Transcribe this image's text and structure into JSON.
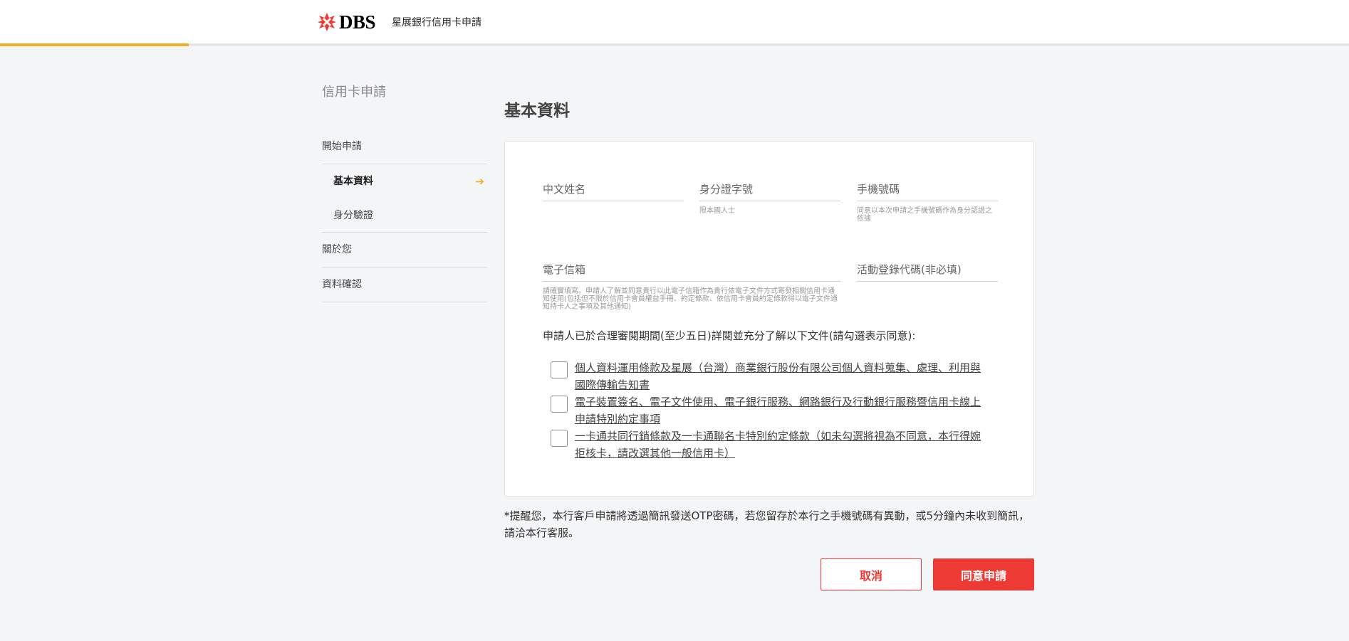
{
  "header": {
    "logo_text": "DBS",
    "title": "星展銀行信用卡申請",
    "progress": 0.14,
    "accent_color": "#f6ad23",
    "brand_color": "#ee3a34"
  },
  "sidebar": {
    "heading": "信用卡申請",
    "items": [
      {
        "label": "開始申請"
      },
      {
        "label": "基本資料",
        "active": true
      },
      {
        "label": "身分驗證"
      },
      {
        "label": "關於您"
      },
      {
        "label": "資料確認"
      }
    ],
    "active_icon": "arrow-right-icon"
  },
  "main": {
    "title": "基本資料",
    "fields": {
      "chinese_name": {
        "label": "中文姓名"
      },
      "id_number": {
        "label": "身分證字號",
        "hint": "限本國人士"
      },
      "mobile": {
        "label": "手機號碼",
        "hint": "同意以本次申請之手機號碼作為身分認證之依據"
      },
      "email": {
        "label": "電子信箱",
        "hint": "請確實填寫。申請人了解並同意貴行以此電子信箱作為貴行依電子文件方式寄發相關信用卡通知使用(包括但不限於信用卡會員權益手冊、約定條款、依信用卡會員約定條款得以電子文件通知持卡人之事項及其他通知)"
      },
      "promo_code": {
        "label": "活動登錄代碼(非必填)"
      }
    },
    "consent_title": "申請人已於合理審閱期間(至少五日)詳閱並充分了解以下文件(請勾選表示同意):",
    "consents": [
      {
        "text": "個人資料運用條款及星展（台灣）商業銀行股份有限公司個人資料蒐集、處理、利用與國際傳輸告知書",
        "checked": false
      },
      {
        "text": "電子裝置簽名、電子文件使用、電子銀行服務、網路銀行及行動銀行服務暨信用卡線上申請特別約定事項",
        "checked": false
      },
      {
        "text": "一卡通共同行銷條款及一卡通聯名卡特別約定條款（如未勾選將視為不同意，本行得婉拒核卡，請改選其他一般信用卡）",
        "checked": false
      }
    ],
    "notice": "*提醒您，本行客戶申請將透過簡訊發送OTP密碼，若您留存於本行之手機號碼有異動，或5分鐘內未收到簡訊，請洽本行客服。"
  },
  "actions": {
    "cancel_label": "取消",
    "agree_label": "同意申請"
  }
}
